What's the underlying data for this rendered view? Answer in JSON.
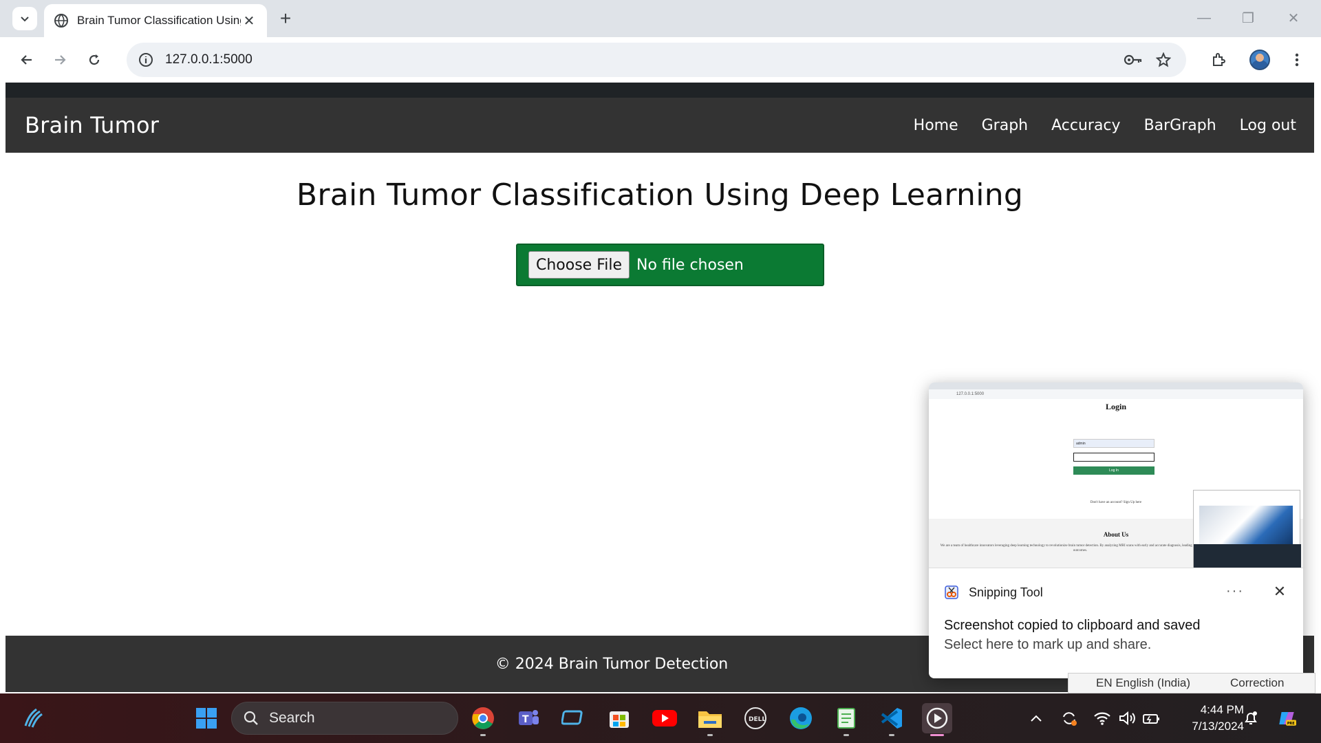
{
  "browser": {
    "tab_title": "Brain Tumor Classification Using Deep Learning",
    "url": "127.0.0.1:5000",
    "new_tab_label": "+"
  },
  "page": {
    "brand": "Brain Tumor",
    "nav": [
      "Home",
      "Graph",
      "Accuracy",
      "BarGraph",
      "Log out"
    ],
    "headline": "Brain Tumor Classification Using Deep Learning",
    "file_button": "Choose File",
    "file_status": "No file chosen",
    "footer": "© 2024 Brain Tumor Detection"
  },
  "notification": {
    "app": "Snipping Tool",
    "more": "···",
    "title": "Screenshot copied to clipboard and saved",
    "subtitle": "Select here to mark up and share.",
    "thumbnail": {
      "url": "127.0.0.1:5000",
      "heading": "Login",
      "username_value": "admin",
      "login_button": "Log In",
      "signup_text": "Don't have an account? Sign Up here",
      "about_heading": "About Us",
      "about_text": "We are a team of healthcare innovators leveraging deep learning technology to revolutionize brain tumor detection. By analyzing MRI scans with early and accurate diagnosis, leading to improved patient outcomes."
    }
  },
  "ime": {
    "language": "EN English (India)",
    "correction": "Correction"
  },
  "taskbar": {
    "search_label": "Search",
    "time": "4:44 PM",
    "date": "7/13/2024"
  },
  "colors": {
    "navbar": "#333333",
    "upload_green": "#0b7a33",
    "footer": "#333333"
  }
}
